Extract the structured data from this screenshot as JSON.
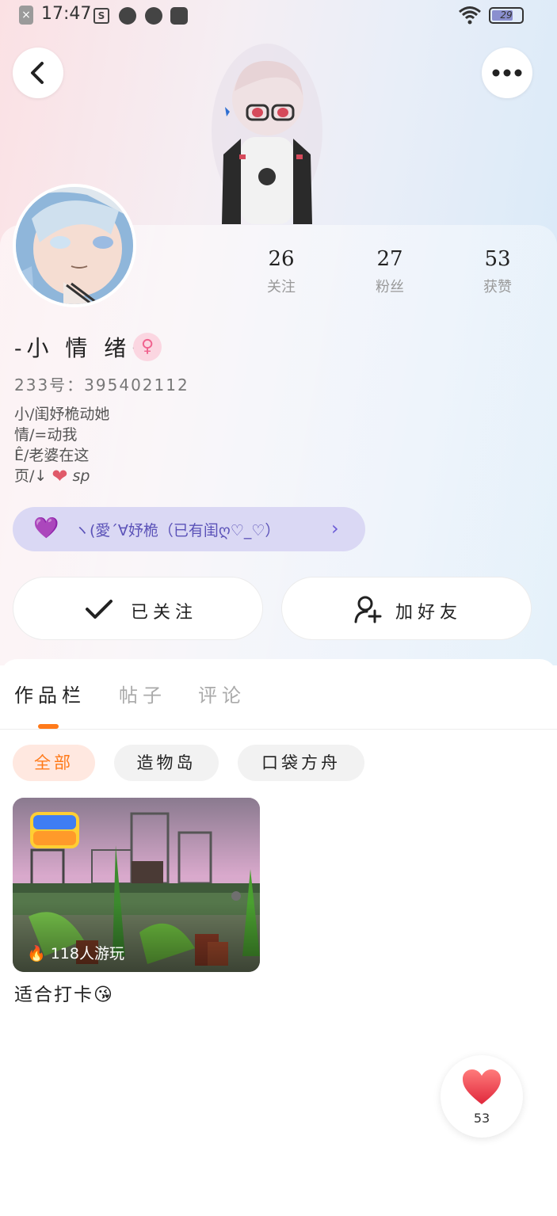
{
  "status_bar": {
    "time": "17:47",
    "battery": "29"
  },
  "profile": {
    "stats": [
      {
        "value": "26",
        "label": "关注"
      },
      {
        "value": "27",
        "label": "粉丝"
      },
      {
        "value": "53",
        "label": "获赞"
      }
    ],
    "username": "-小 情 绪·",
    "gender_icon": "female-icon",
    "uid": "233号：395402112",
    "bio_lines": [
      "小/闺妤桅动她",
      "情/=动我",
      "Ê/老婆在这",
      "页/↓"
    ],
    "bio_tail": "sp",
    "tag_text": "ヽ(愛´∀妤桅（已有闺ღ♡_♡）"
  },
  "actions": {
    "follow_label": "已关注",
    "friend_label": "加好友"
  },
  "tabs": [
    "作品栏",
    "帖子",
    "评论"
  ],
  "chips": [
    "全部",
    "造物岛",
    "口袋方舟"
  ],
  "game": {
    "plays": "118人游玩",
    "title": "适合打卡😘"
  },
  "like": {
    "count": "53"
  },
  "colors": {
    "accent": "#ff7a1a",
    "tag_bg": "#dad8f4",
    "tag_text": "#5b52b8"
  }
}
